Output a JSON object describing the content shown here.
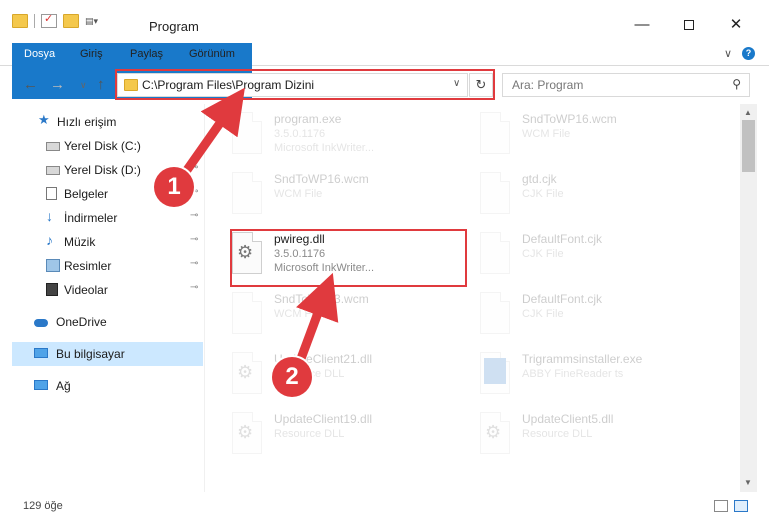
{
  "window": {
    "title": "Program",
    "minimize_label": "—",
    "close_label": "✕"
  },
  "ribbon": {
    "tabs": [
      "Dosya",
      "Giriş",
      "Paylaş",
      "Görünüm"
    ],
    "help_label": "?",
    "expand_label": "∨"
  },
  "nav": {
    "back_label": "←",
    "forward_label": "→",
    "recent_label": "∨",
    "up_label": "↑",
    "address": "C:\\Program Files\\Program Dizini",
    "address_dropdown_label": "∨",
    "refresh_label": "↻",
    "search_placeholder": "Ara: Program",
    "search_icon_label": "⚲"
  },
  "sidebar": {
    "items": [
      {
        "label": "Hızlı erişim",
        "icon": "star-icon",
        "pinned": false
      },
      {
        "label": "Yerel Disk (C:)",
        "icon": "drive-icon",
        "pinned": false
      },
      {
        "label": "Yerel Disk (D:)",
        "icon": "drive-icon",
        "pinned": true
      },
      {
        "label": "Belgeler",
        "icon": "documents-icon",
        "pinned": true
      },
      {
        "label": "İndirmeler",
        "icon": "download-icon",
        "pinned": true
      },
      {
        "label": "Müzik",
        "icon": "music-icon",
        "pinned": true
      },
      {
        "label": "Resimler",
        "icon": "pictures-icon",
        "pinned": true
      },
      {
        "label": "Videolar",
        "icon": "video-icon",
        "pinned": true
      },
      {
        "label": "OneDrive",
        "icon": "cloud-icon",
        "pinned": false
      },
      {
        "label": "Bu bilgisayar",
        "icon": "computer-icon",
        "pinned": false
      },
      {
        "label": "Ağ",
        "icon": "network-icon",
        "pinned": false
      }
    ],
    "pin_glyph": "📌"
  },
  "files": [
    {
      "name": "program.exe",
      "line1": "3.5.0.1176",
      "line2": "Microsoft InkWriter...",
      "icon": "exe-icon"
    },
    {
      "name": "SndToWP16.wcm",
      "line1": "WCM File",
      "line2": "",
      "icon": "file-icon"
    },
    {
      "name": "SndToWP16.wcm",
      "line1": "WCM File",
      "line2": "",
      "icon": "file-icon"
    },
    {
      "name": "gtd.cjk",
      "line1": "CJK File",
      "line2": "",
      "icon": "file-icon"
    },
    {
      "name": "pwireg.dll",
      "line1": "3.5.0.1176",
      "line2": "Microsoft InkWriter...",
      "icon": "dll-icon"
    },
    {
      "name": "DefaultFont.cjk",
      "line1": "CJK File",
      "line2": "",
      "icon": "file-icon"
    },
    {
      "name": "SndToWP13.wcm",
      "line1": "WCM File",
      "line2": "",
      "icon": "file-icon"
    },
    {
      "name": "DefaultFont.cjk",
      "line1": "CJK File",
      "line2": "",
      "icon": "file-icon"
    },
    {
      "name": "UpdateClient21.dll",
      "line1": "Resource DLL",
      "line2": "",
      "icon": "dll-icon"
    },
    {
      "name": "Trigrammsinstaller.exe",
      "line1": "ABBY FineReader ts",
      "line2": "",
      "icon": "app-icon"
    },
    {
      "name": "UpdateClient19.dll",
      "line1": "Resource DLL",
      "line2": "",
      "icon": "dll-icon"
    },
    {
      "name": "UpdateClient5.dll",
      "line1": "Resource DLL",
      "line2": "",
      "icon": "dll-icon"
    }
  ],
  "status": {
    "item_count": "129 öğe"
  },
  "annotations": {
    "step1": "1",
    "step2": "2",
    "color": "#e03a3e"
  }
}
